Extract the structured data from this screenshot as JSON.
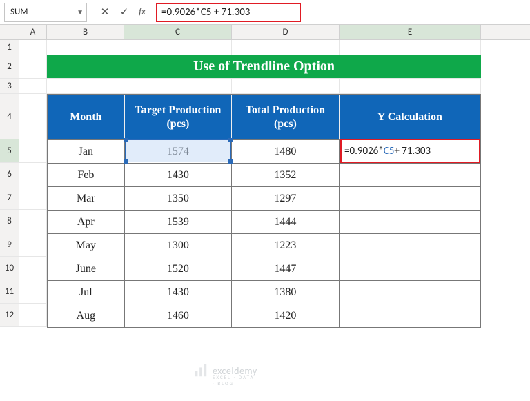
{
  "formula_bar": {
    "name_box": "SUM",
    "fx_label": "fx",
    "formula_text": "=0.9026*C5 + 71.303"
  },
  "columns": [
    "A",
    "B",
    "C",
    "D",
    "E"
  ],
  "rows": [
    "1",
    "2",
    "3",
    "4",
    "5",
    "6",
    "7",
    "8",
    "9",
    "10",
    "11",
    "12"
  ],
  "title": "Use of Trendline Option",
  "table_headers": {
    "month": "Month",
    "target": "Target Production (pcs)",
    "total": "Total Production (pcs)",
    "yc": "Y Calculation"
  },
  "data": [
    {
      "month": "Jan",
      "target": "1574",
      "total": "1480"
    },
    {
      "month": "Feb",
      "target": "1430",
      "total": "1352"
    },
    {
      "month": "Mar",
      "target": "1350",
      "total": "1297"
    },
    {
      "month": "Apr",
      "target": "1539",
      "total": "1444"
    },
    {
      "month": "May",
      "target": "1300",
      "total": "1223"
    },
    {
      "month": "June",
      "target": "1520",
      "total": "1447"
    },
    {
      "month": "Jul",
      "target": "1430",
      "total": "1380"
    },
    {
      "month": "Aug",
      "target": "1460",
      "total": "1420"
    }
  ],
  "e5_edit": {
    "prefix": "=0.9026*",
    "ref": "C5",
    "suffix": " + 71.303"
  },
  "watermark": {
    "brand": "exceldemy",
    "tagline": "EXCEL · DATA · BLOG"
  }
}
